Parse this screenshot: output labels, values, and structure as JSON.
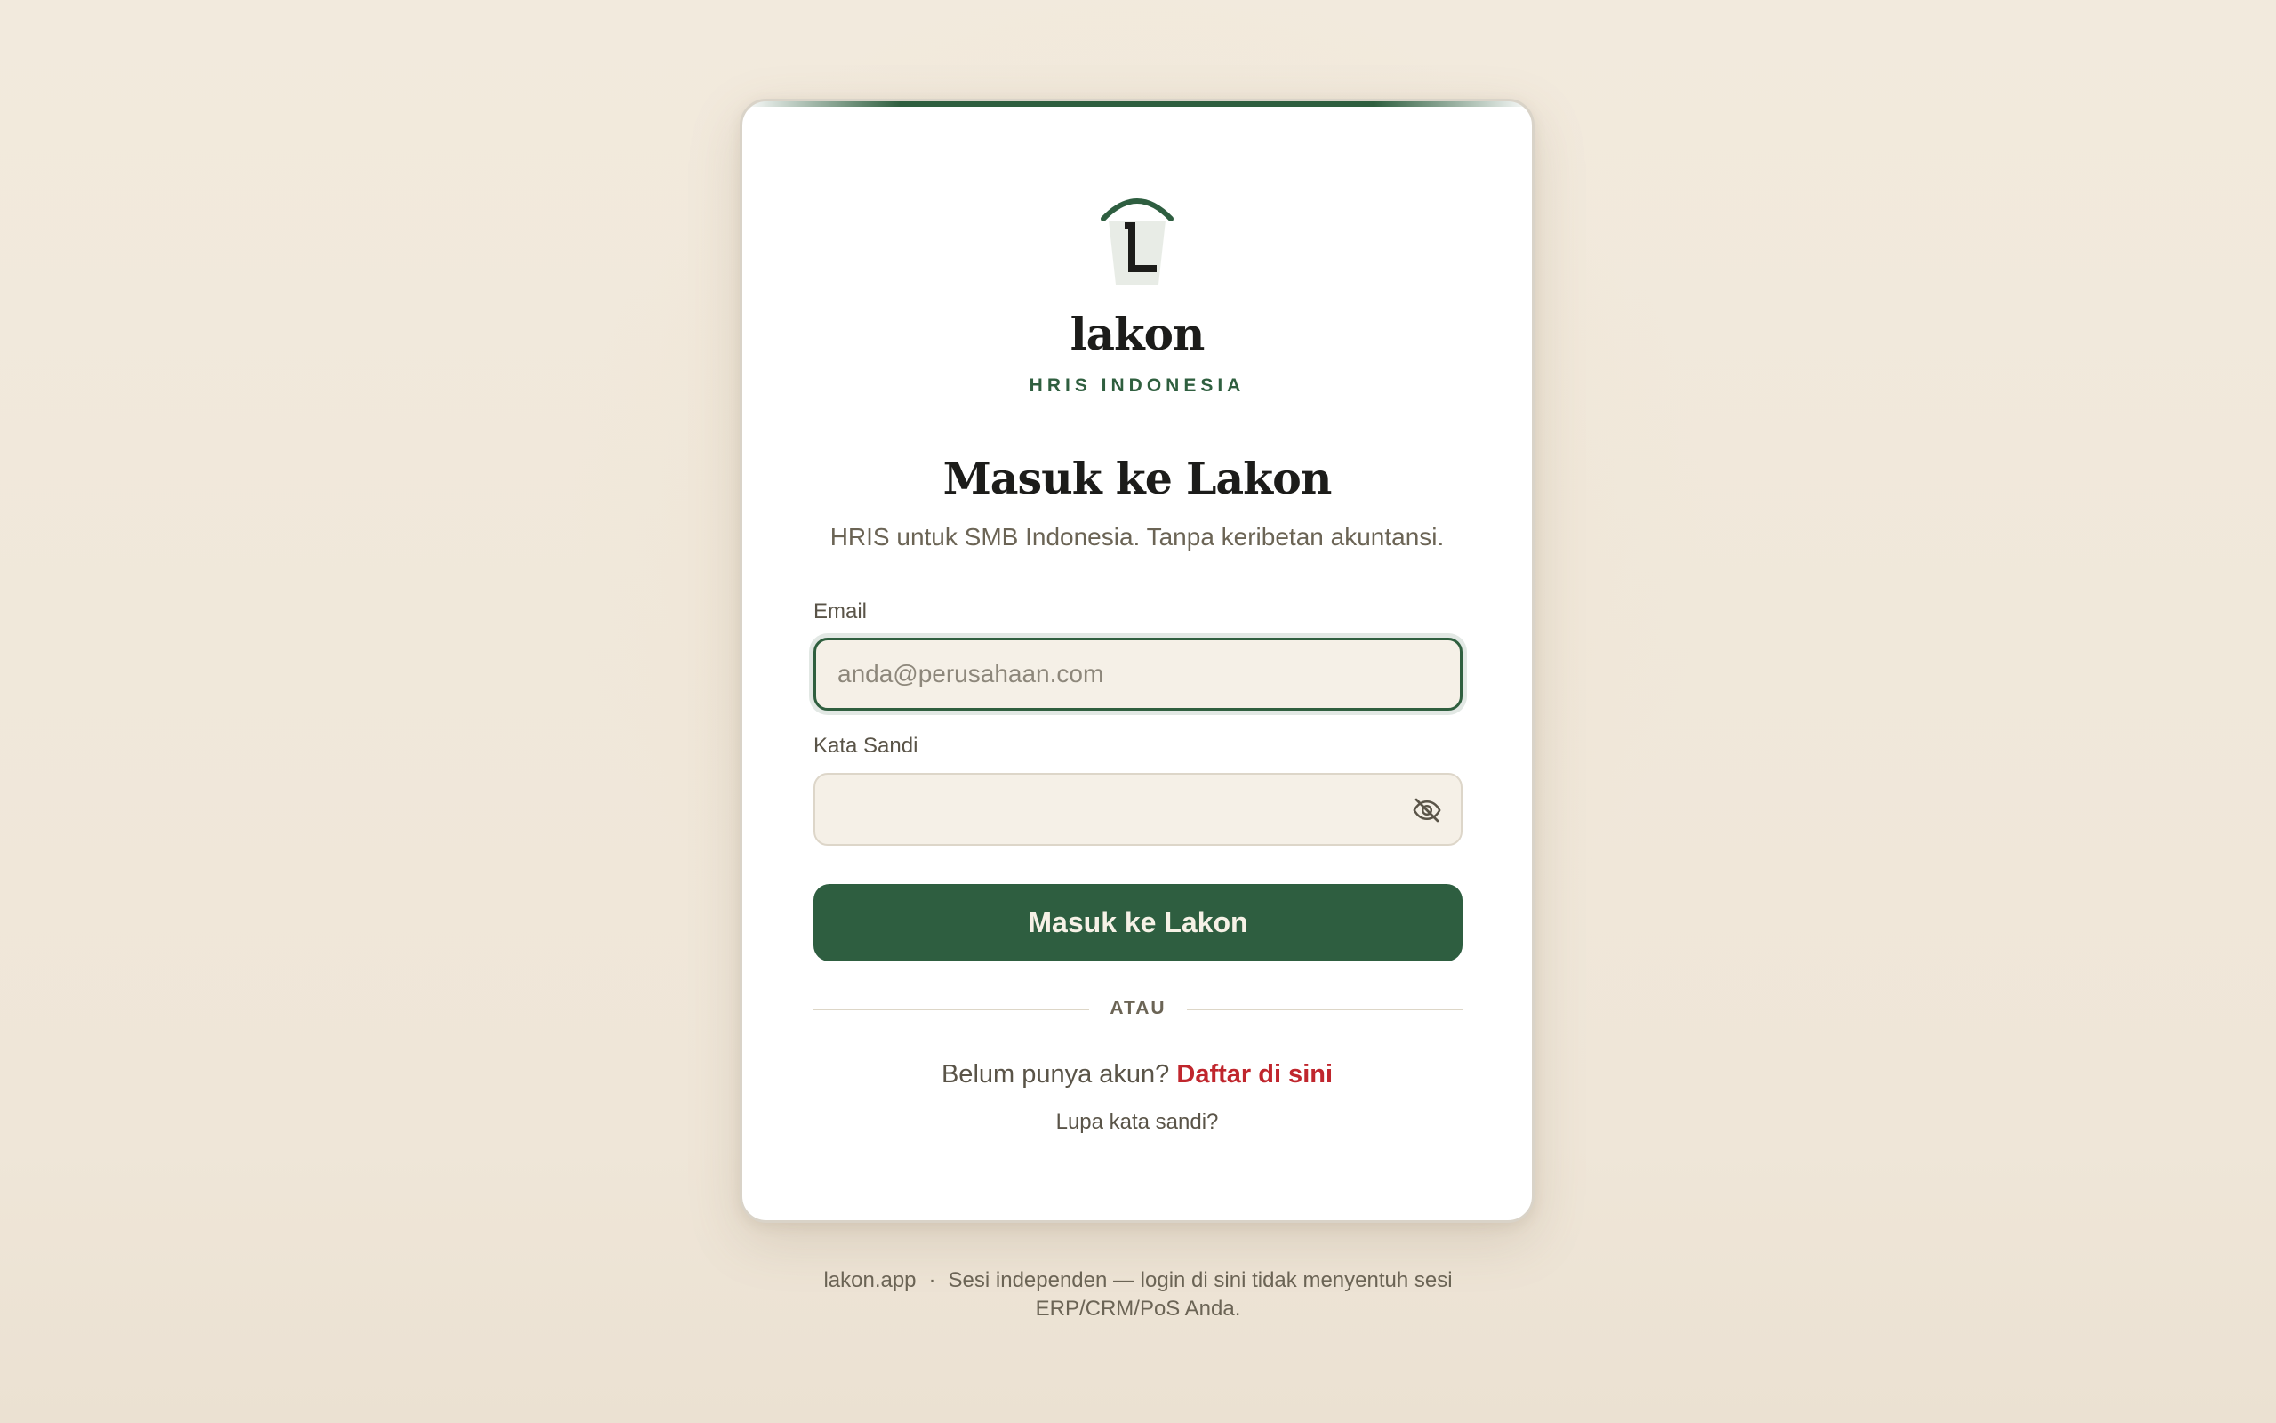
{
  "brand": {
    "name": "lakon",
    "tagline": "HRIS INDONESIA"
  },
  "login": {
    "title": "Masuk ke Lakon",
    "subtitle": "HRIS untuk SMB Indonesia. Tanpa keribetan akuntansi.",
    "email_label": "Email",
    "email_placeholder": "anda@perusahaan.com",
    "email_value": "",
    "password_label": "Kata Sandi",
    "password_value": "",
    "password_toggle_icon": "eye-off-icon",
    "submit_label": "Masuk ke Lakon",
    "divider_text": "ATAU",
    "register_prompt": "Belum punya akun?",
    "register_link": "Daftar di sini",
    "forgot_link": "Lupa kata sandi?"
  },
  "footer": {
    "domain": "lakon.app",
    "separator": "·",
    "note": "Sesi independen — login di sini tidak menyentuh sesi ERP/CRM/PoS Anda."
  },
  "colors": {
    "background": "#f1e9dc",
    "card": "#ffffff",
    "primary": "#2e5e40",
    "link": "#c0262d",
    "input_bg": "#f5f0e7"
  }
}
